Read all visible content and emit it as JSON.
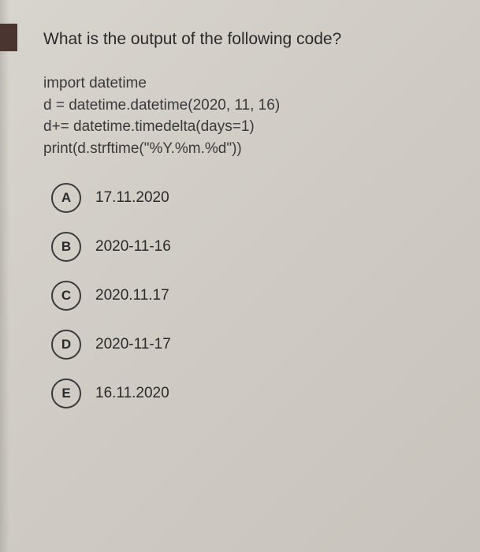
{
  "question": {
    "title": "What is the output of the following code?",
    "code": {
      "line1": "import datetime",
      "line2": "d = datetime.datetime(2020, 11, 16)",
      "line3": "d+= datetime.timedelta(days=1)",
      "line4": "print(d.strftime(\"%Y.%m.%d\"))"
    },
    "options": [
      {
        "letter": "A",
        "text": "17.11.2020"
      },
      {
        "letter": "B",
        "text": "2020-11-16"
      },
      {
        "letter": "C",
        "text": "2020.11.17"
      },
      {
        "letter": "D",
        "text": "2020-11-17"
      },
      {
        "letter": "E",
        "text": "16.11.2020"
      }
    ]
  }
}
